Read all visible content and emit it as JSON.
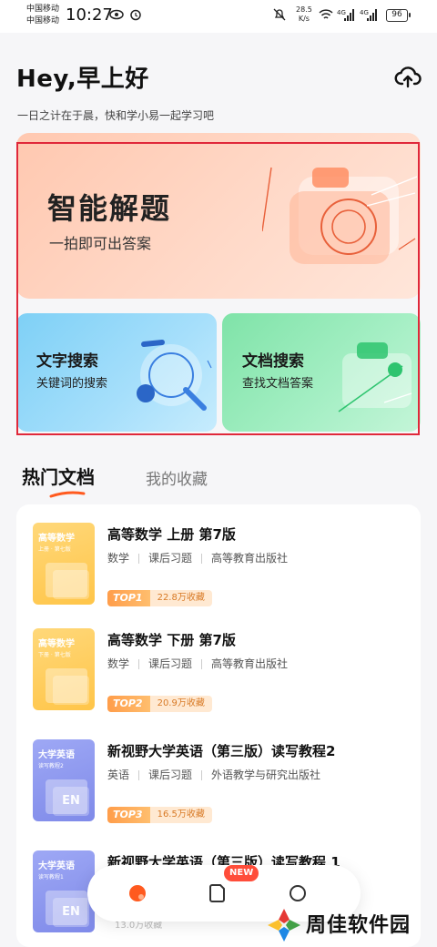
{
  "status_bar": {
    "carrier_1": "中国移动",
    "carrier_2": "中国移动",
    "time": "10:27",
    "net_speed_value": "28.5",
    "net_speed_unit": "K/s",
    "signal_1": "4G",
    "signal_2": "4G",
    "battery": "96"
  },
  "header": {
    "greeting": "Hey,早上好",
    "subtitle": "一日之计在于晨，快和学小易一起学习吧"
  },
  "features": {
    "solve": {
      "title": "智能解题",
      "desc": "一拍即可出答案"
    },
    "text_search": {
      "title": "文字搜索",
      "desc": "关键词的搜索"
    },
    "doc_search": {
      "title": "文档搜索",
      "desc": "查找文档答案"
    }
  },
  "tabs": [
    {
      "label": "热门文档",
      "active": true
    },
    {
      "label": "我的收藏",
      "active": false
    }
  ],
  "documents": [
    {
      "title": "高等数学 上册 第7版",
      "tags": [
        "数学",
        "课后习题",
        "高等教育出版社"
      ],
      "rank": "TOP1",
      "favorites": "22.8万收藏",
      "cover_title": "高等数学",
      "cover_sub": "上册 · 第七版",
      "cover_color": "#ffcc55"
    },
    {
      "title": "高等数学 下册 第7版",
      "tags": [
        "数学",
        "课后习题",
        "高等教育出版社"
      ],
      "rank": "TOP2",
      "favorites": "20.9万收藏",
      "cover_title": "高等数学",
      "cover_sub": "下册 · 第七版",
      "cover_color": "#ffcc55"
    },
    {
      "title": "新视野大学英语（第三版）读写教程2",
      "tags": [
        "英语",
        "课后习题",
        "外语教学与研究出版社"
      ],
      "rank": "TOP3",
      "favorites": "16.5万收藏",
      "cover_title": "大学英语",
      "cover_sub": "读写教程2",
      "cover_logo": "EN",
      "cover_color": "#8b95ef"
    },
    {
      "title": "新视野大学英语（第三版）读写教程 1",
      "tags": [],
      "rank": "",
      "favorites": "13.0万收藏",
      "cover_title": "大学英语",
      "cover_sub": "读写教程1",
      "cover_logo": "EN",
      "cover_color": "#8b95ef"
    }
  ],
  "bottom_nav": {
    "items": [
      {
        "icon": "home-dot-icon",
        "active": true
      },
      {
        "icon": "document-icon",
        "badge": "NEW"
      },
      {
        "icon": "profile-circle-icon"
      }
    ]
  },
  "watermark": {
    "text": "周佳软件园"
  },
  "colors": {
    "accent": "#ff5a1f",
    "highlight_border": "#e0283a",
    "rank_badge": "#ff9d4a"
  }
}
